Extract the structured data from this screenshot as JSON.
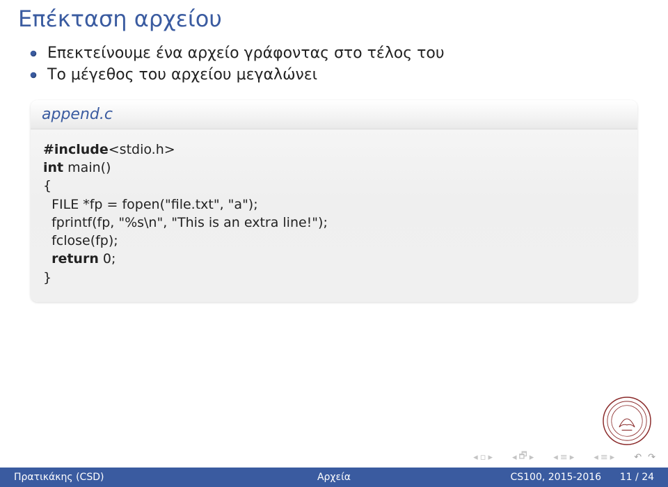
{
  "title": "Επέκταση αρχείου",
  "bullets": [
    "Επεκτείνουμε ένα αρχείο γράφοντας στο τέλος του",
    "Το μέγεθος του αρχείου μεγαλώνει"
  ],
  "code": {
    "filename": "append.c",
    "include_kw": "#include",
    "include_arg": "<stdio.h>",
    "int_kw": "int",
    "main_sig": " main()",
    "brace_open": "{",
    "line1_pre": "  FILE *fp = fopen(\"file.txt\", \"a\");",
    "line2_pre": "  fprintf(fp, \"%s\\n\", \"This is an extra line!\");",
    "line3_pre": "  fclose(fp);",
    "return_kw": "return",
    "return_indent": "  ",
    "return_rest": " 0;",
    "brace_close": "}"
  },
  "footer": {
    "left": "Πρατικάκης (CSD)",
    "center": "Αρχεία",
    "right_course": "CS100, 2015-2016",
    "right_page": "11 / 24"
  }
}
